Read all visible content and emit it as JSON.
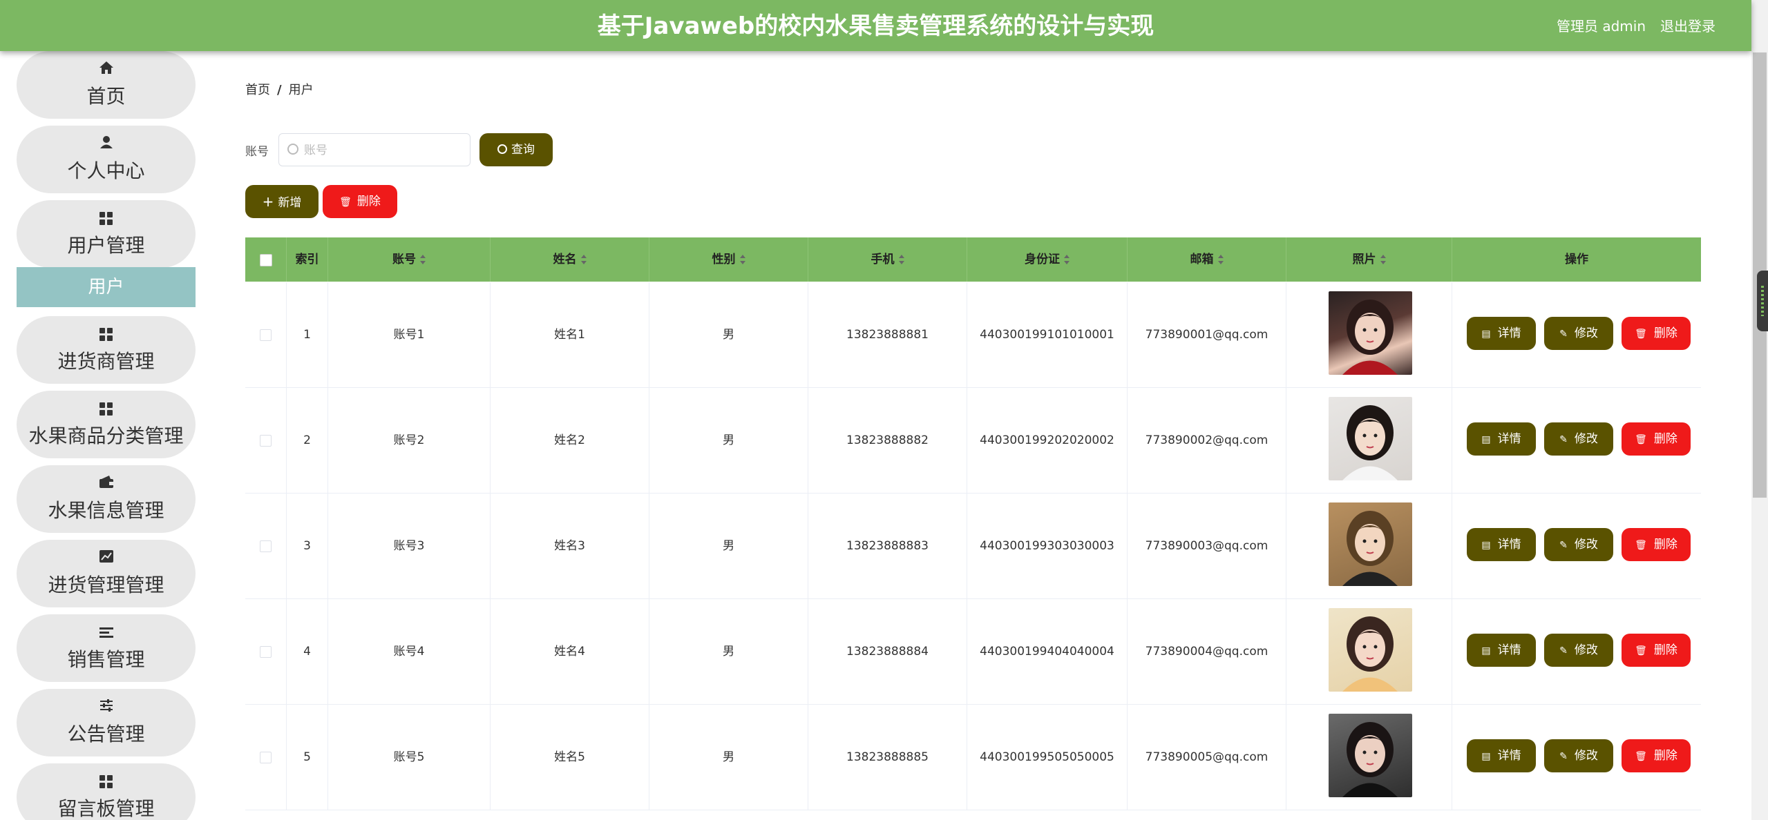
{
  "header": {
    "title": "基于Javaweb的校内水果售卖管理系统的设计与实现",
    "user_label": "管理员 admin",
    "logout_label": "退出登录"
  },
  "sidebar": {
    "items": [
      {
        "label": "首页",
        "icon": "home-icon"
      },
      {
        "label": "个人中心",
        "icon": "person-icon"
      },
      {
        "label": "用户管理",
        "icon": "grid-icon"
      },
      {
        "label": "进货商管理",
        "icon": "grid-icon"
      },
      {
        "label": "水果商品分类管理",
        "icon": "grid-icon"
      },
      {
        "label": "水果信息管理",
        "icon": "wallet-icon"
      },
      {
        "label": "进货管理管理",
        "icon": "chart-icon"
      },
      {
        "label": "销售管理",
        "icon": "list-icon"
      },
      {
        "label": "公告管理",
        "icon": "sliders-icon"
      },
      {
        "label": "留言板管理",
        "icon": "grid-icon"
      }
    ],
    "submenu_active": "用户"
  },
  "breadcrumb": {
    "home": "首页",
    "separator": "/",
    "current": "用户"
  },
  "search": {
    "label": "账号",
    "placeholder": "账号",
    "value": "",
    "button_label": "查询"
  },
  "toolbar": {
    "add_label": "新增",
    "delete_label": "删除"
  },
  "table": {
    "columns": [
      "索引",
      "账号",
      "姓名",
      "性别",
      "手机",
      "身份证",
      "邮箱",
      "照片",
      "操作"
    ],
    "rows": [
      {
        "index": "1",
        "account": "账号1",
        "name": "姓名1",
        "gender": "男",
        "phone": "13823888881",
        "id_card": "440300199101010001",
        "email": "773890001@qq.com"
      },
      {
        "index": "2",
        "account": "账号2",
        "name": "姓名2",
        "gender": "男",
        "phone": "13823888882",
        "id_card": "440300199202020002",
        "email": "773890002@qq.com"
      },
      {
        "index": "3",
        "account": "账号3",
        "name": "姓名3",
        "gender": "男",
        "phone": "13823888883",
        "id_card": "440300199303030003",
        "email": "773890003@qq.com"
      },
      {
        "index": "4",
        "account": "账号4",
        "name": "姓名4",
        "gender": "男",
        "phone": "13823888884",
        "id_card": "440300199404040004",
        "email": "773890004@qq.com"
      },
      {
        "index": "5",
        "account": "账号5",
        "name": "姓名5",
        "gender": "男",
        "phone": "13823888885",
        "id_card": "440300199505050005",
        "email": "773890005@qq.com"
      }
    ],
    "action_labels": {
      "detail": "详情",
      "edit": "修改",
      "delete": "删除"
    }
  },
  "colors": {
    "header_bg": "#7cb862",
    "submenu_active_bg": "#94c4c4",
    "menu_bg": "#e8e8e8",
    "olive_button": "#5a5200",
    "danger_button": "#ef1a1a"
  }
}
